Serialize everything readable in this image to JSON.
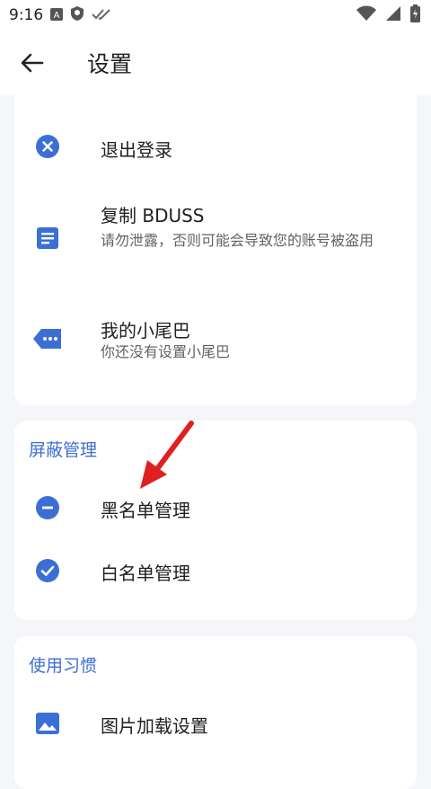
{
  "status_bar": {
    "time": "9:16",
    "left_icons": [
      "a-badge-icon",
      "shield-icon",
      "double-check-icon"
    ],
    "right_icons": [
      "wifi-icon",
      "signal-icon",
      "battery-charging-icon"
    ]
  },
  "app_bar": {
    "back_icon": "arrow-left-icon",
    "title": "设置"
  },
  "account_section": {
    "items": [
      {
        "title": "退出登录",
        "icon": "close-circle-icon"
      },
      {
        "title": "复制 BDUSS",
        "subtitle": "请勿泄露，否则可能会导致您的账号被盗用",
        "icon": "document-icon"
      },
      {
        "title": "我的小尾巴",
        "subtitle": "你还没有设置小尾巴",
        "icon": "tag-icon"
      }
    ]
  },
  "block_section": {
    "title": "屏蔽管理",
    "items": [
      {
        "title": "黑名单管理",
        "icon": "minus-circle-icon"
      },
      {
        "title": "白名单管理",
        "icon": "check-circle-icon"
      }
    ]
  },
  "habit_section": {
    "title": "使用习惯",
    "items": [
      {
        "title": "图片加载设置",
        "icon": "image-icon"
      }
    ]
  },
  "colors": {
    "accent": "#3e6fd1",
    "icon_blue": "#3b6fd6",
    "annotation_red": "#e02020",
    "background": "#f5f6fa"
  }
}
